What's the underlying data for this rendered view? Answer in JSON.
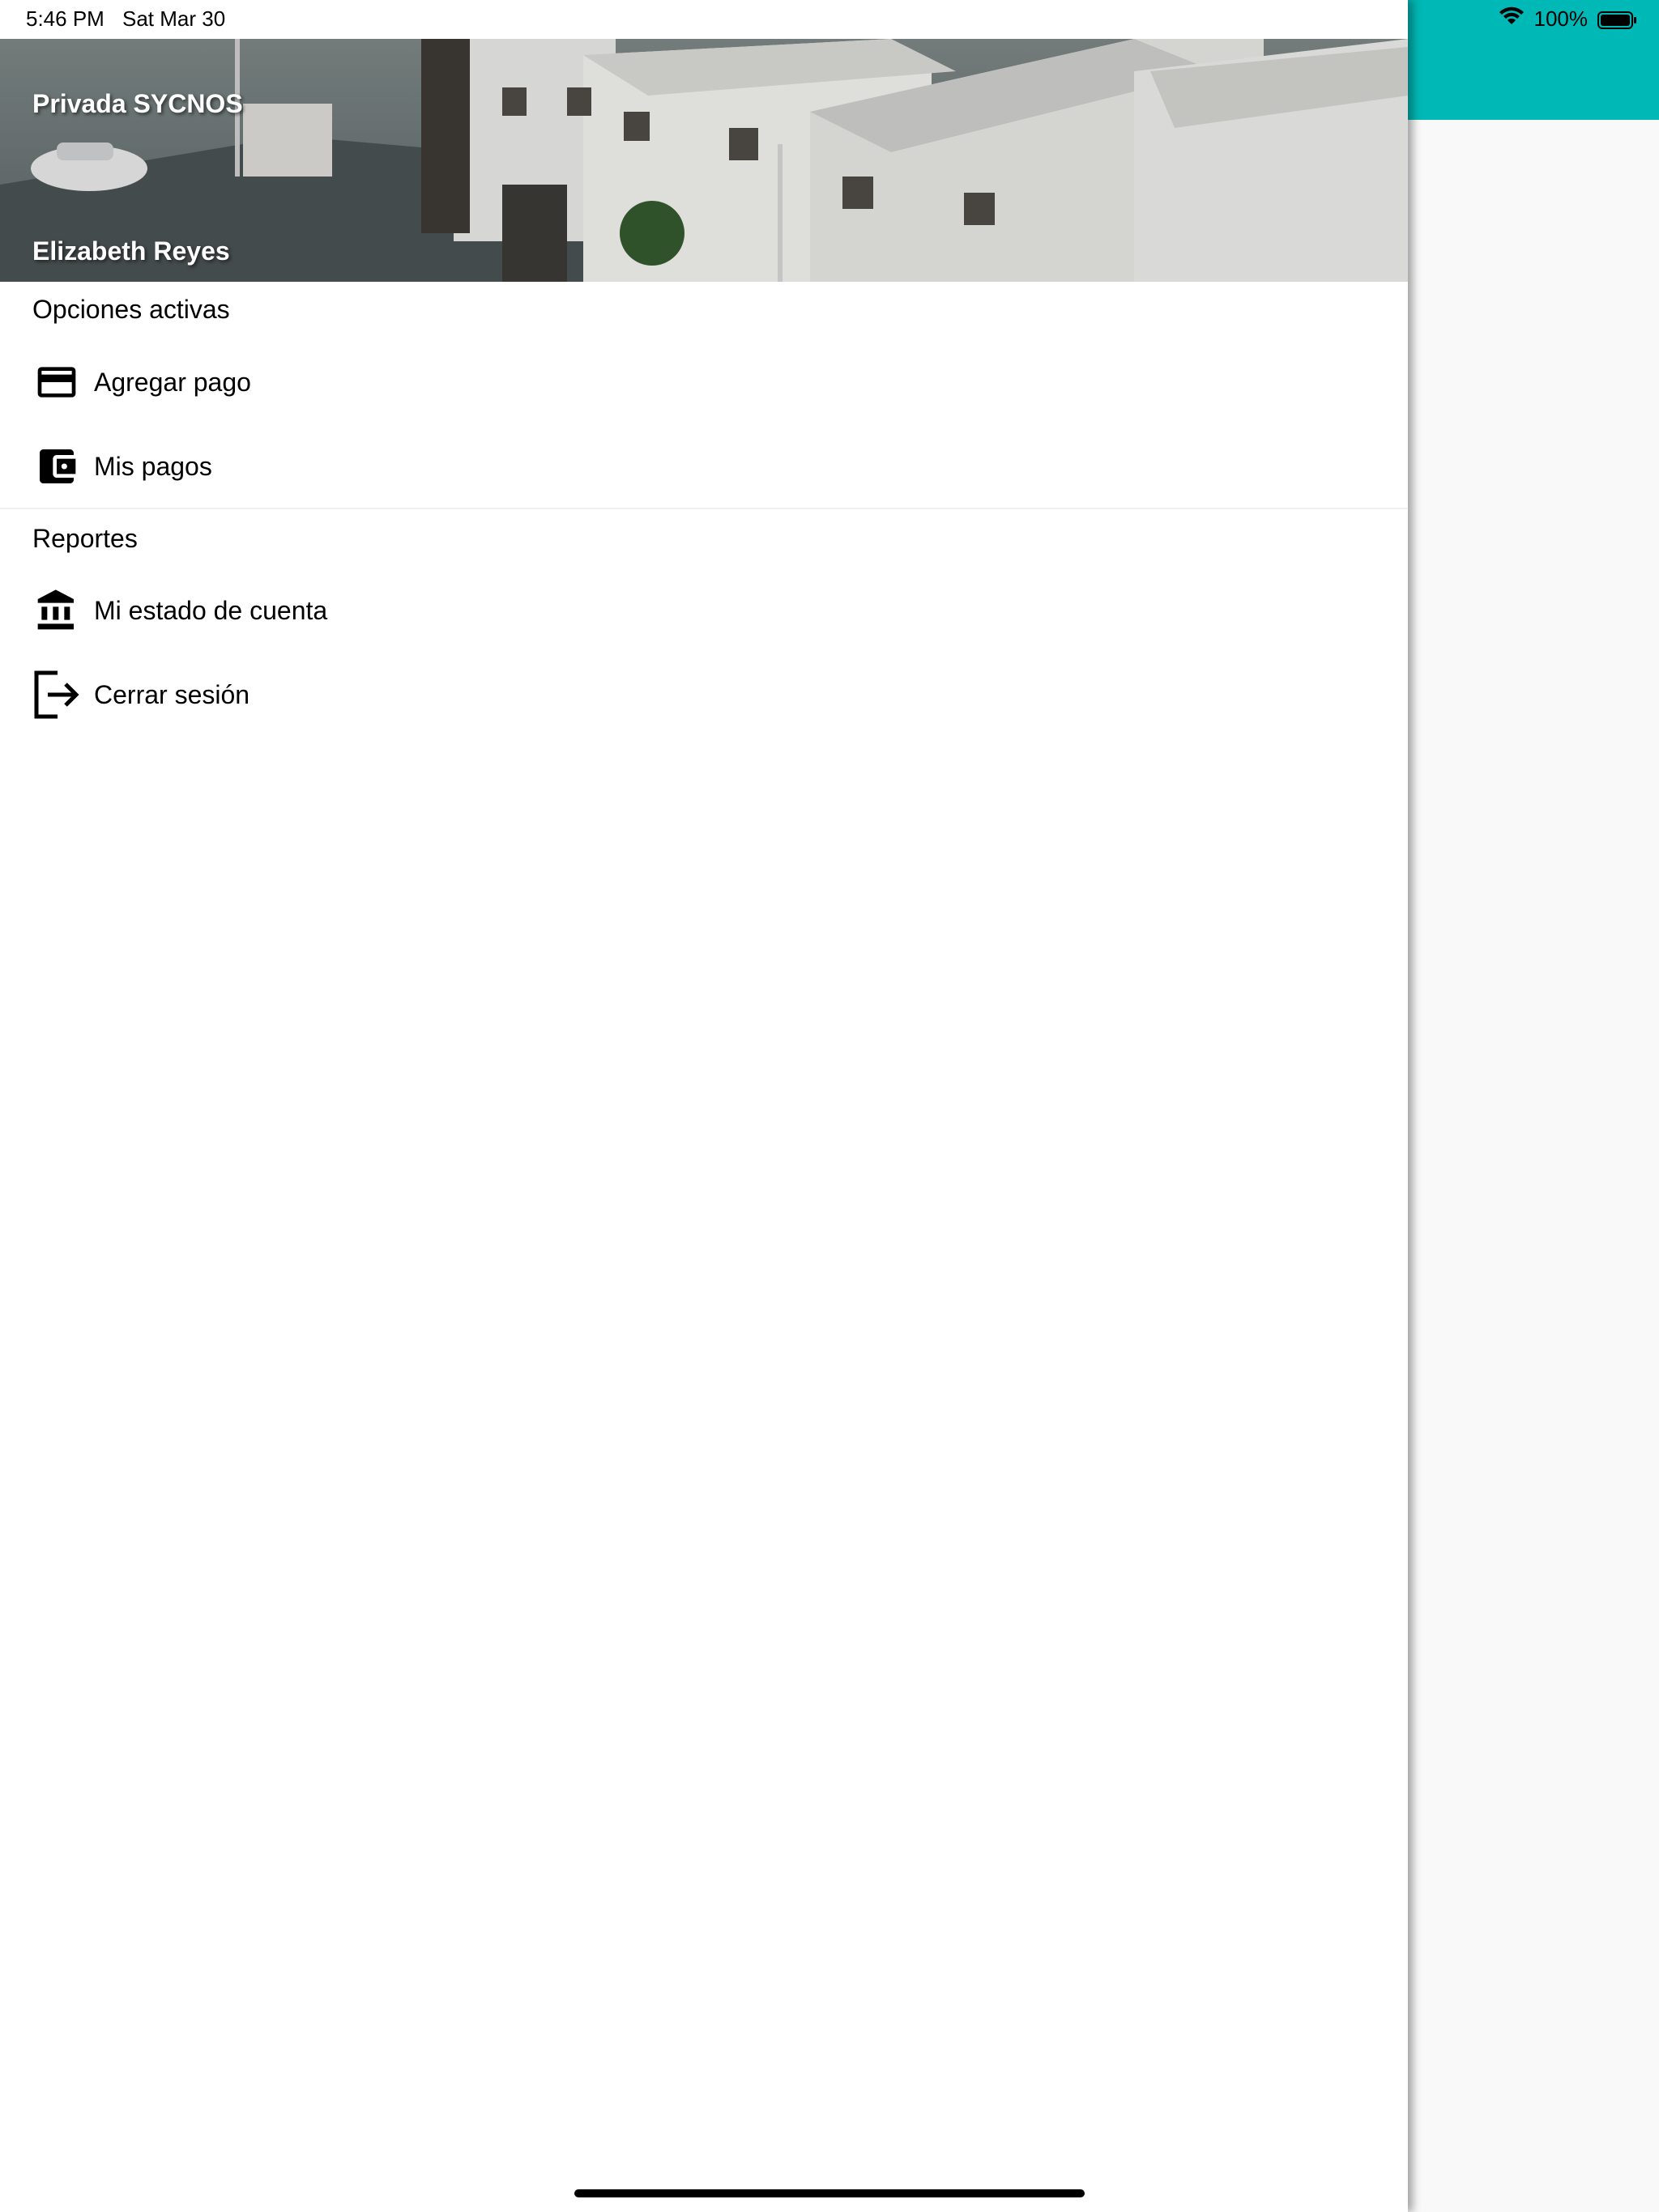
{
  "status_bar": {
    "time": "5:46 PM",
    "date": "Sat Mar 30",
    "battery": "100%",
    "icons": [
      "wifi-icon",
      "battery-icon"
    ]
  },
  "app": {
    "accent_color": "#00b8b5"
  },
  "drawer": {
    "header": {
      "title": "Privada SYCNOS",
      "user": "Elizabeth Reyes"
    },
    "sections": [
      {
        "title": "Opciones activas",
        "items": [
          {
            "label": "Agregar pago",
            "icon": "credit-card-icon"
          },
          {
            "label": "Mis pagos",
            "icon": "wallet-icon"
          }
        ]
      },
      {
        "title": "Reportes",
        "items": [
          {
            "label": "Mi estado de cuenta",
            "icon": "bank-icon"
          },
          {
            "label": "Cerrar sesión",
            "icon": "logout-icon"
          }
        ]
      }
    ]
  }
}
